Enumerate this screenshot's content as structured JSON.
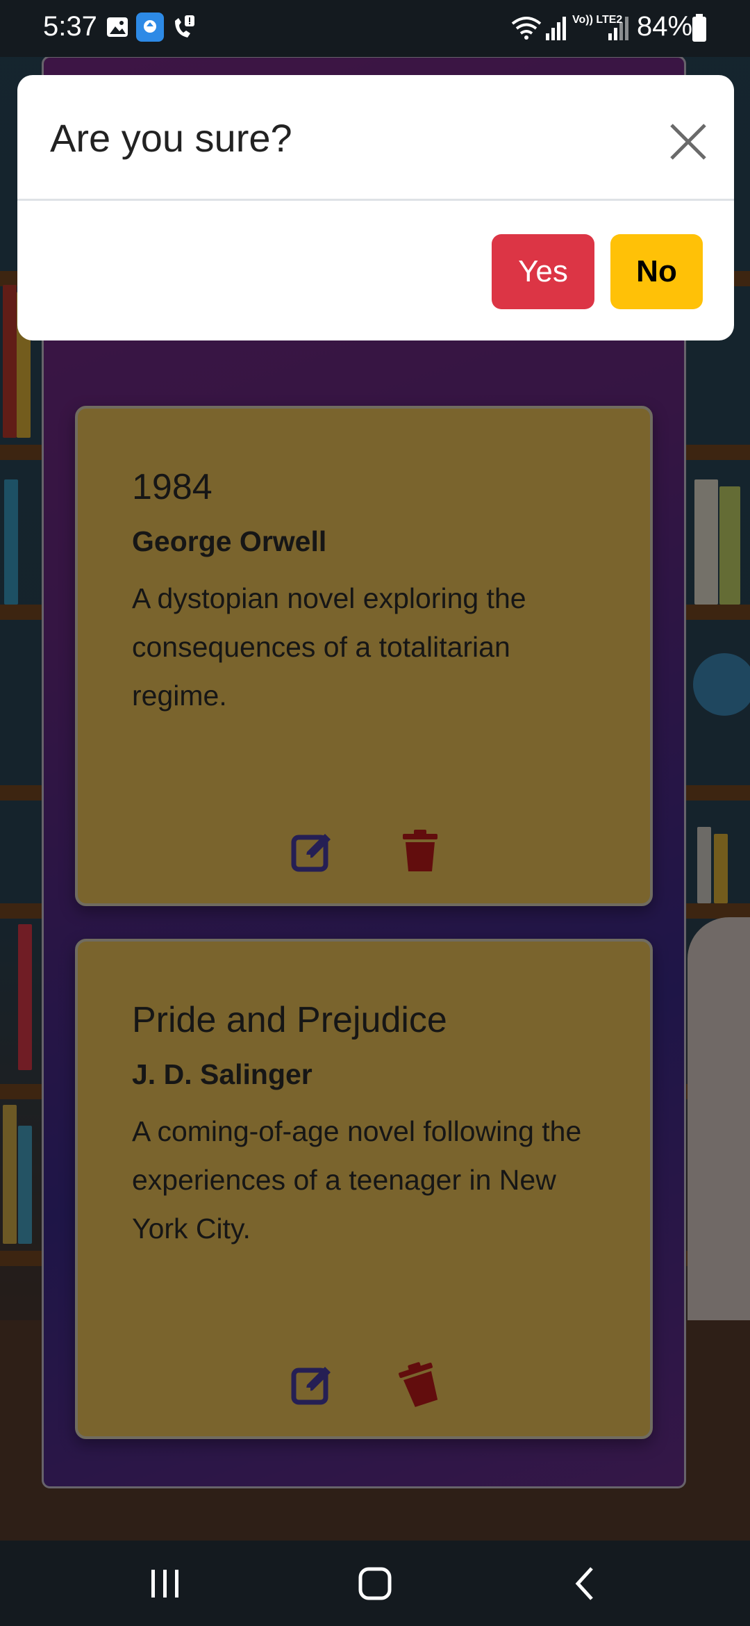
{
  "status_bar": {
    "time": "5:37",
    "battery": "84%",
    "network_label": "Vo)) LTE2",
    "icons": [
      "gallery-icon",
      "cloud-upload-app-icon",
      "call-alert-icon",
      "wifi-icon",
      "signal-icon",
      "battery-icon"
    ]
  },
  "modal": {
    "title": "Are you sure?",
    "close_icon": "close-icon",
    "yes_label": "Yes",
    "no_label": "No"
  },
  "books": [
    {
      "title": "1984",
      "author": "George Orwell",
      "description": "A dystopian novel exploring the consequences of a totalitarian regime."
    },
    {
      "title": "Pride and Prejudice",
      "author": "J. D. Salinger",
      "description": "A coming-of-age novel following the experiences of a teenager in New York City."
    }
  ],
  "card_actions": {
    "edit_icon": "edit-icon",
    "delete_icon": "trash-icon"
  },
  "nav_bar": {
    "icons": [
      "recent-apps-icon",
      "home-icon",
      "back-icon"
    ]
  },
  "colors": {
    "card_background": "#f4c85a",
    "panel_gradient": [
      "#7b2a8a",
      "#3d2b8f"
    ],
    "yes_button": "#dc3545",
    "no_button": "#ffc107",
    "edit_icon": "#4a3fa8",
    "delete_icon": "#c41a1a"
  }
}
